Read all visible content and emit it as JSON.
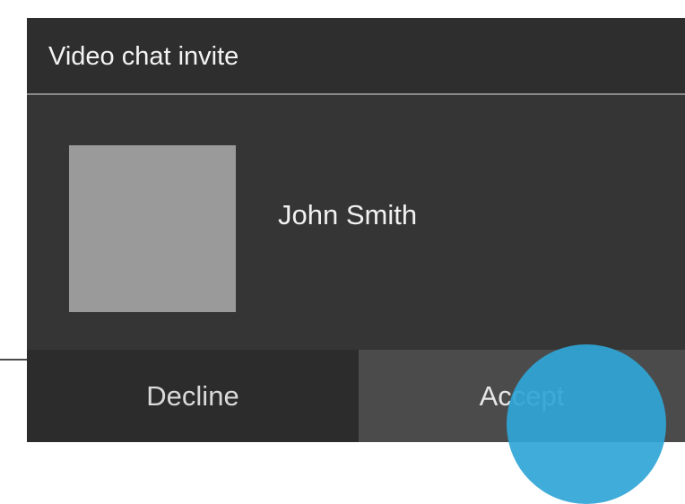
{
  "dialog": {
    "title": "Video chat invite",
    "caller_name": "John Smith",
    "decline_label": "Decline",
    "accept_label": "Accept"
  },
  "colors": {
    "dialog_background": "#353535",
    "title_background": "#2e2e2e",
    "avatar_placeholder": "#9a9a9a",
    "accept_button": "#4b4b4b",
    "touch_indicator": "#30a5d6"
  },
  "icons": {
    "avatar": "avatar-placeholder-icon"
  }
}
